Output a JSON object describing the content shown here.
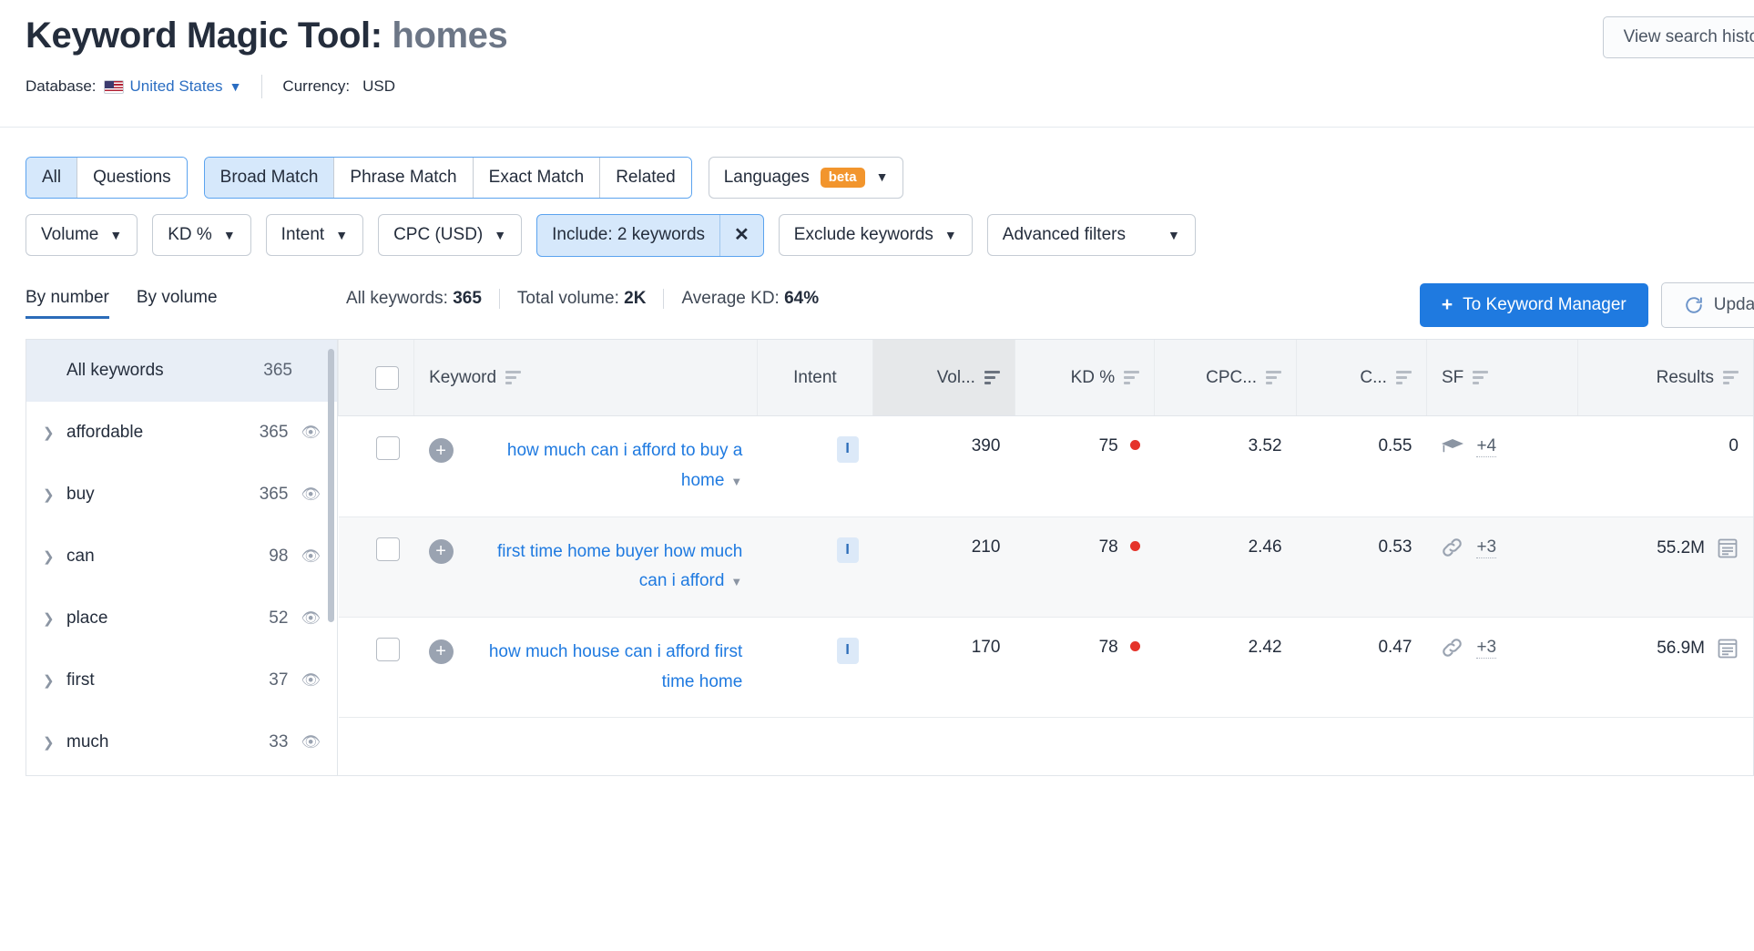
{
  "header": {
    "title_prefix": "Keyword Magic Tool:",
    "title_term": "homes",
    "database_label": "Database:",
    "database_value": "United States",
    "currency_label": "Currency:",
    "currency_value": "USD",
    "view_history_button": "View search history"
  },
  "filters": {
    "type_tabs": [
      {
        "label": "All",
        "active": true
      },
      {
        "label": "Questions",
        "active": false
      }
    ],
    "match_tabs": [
      {
        "label": "Broad Match",
        "active": true
      },
      {
        "label": "Phrase Match",
        "active": false
      },
      {
        "label": "Exact Match",
        "active": false
      },
      {
        "label": "Related",
        "active": false
      }
    ],
    "languages": {
      "label": "Languages",
      "badge": "beta"
    },
    "dropdowns": [
      {
        "label": "Volume"
      },
      {
        "label": "KD %"
      },
      {
        "label": "Intent"
      },
      {
        "label": "CPC (USD)"
      }
    ],
    "include": {
      "label": "Include: 2 keywords",
      "close": "✕"
    },
    "exclude": {
      "label": "Exclude keywords"
    },
    "advanced": {
      "label": "Advanced filters"
    }
  },
  "subbar": {
    "toggles": [
      {
        "label": "By number",
        "active": true
      },
      {
        "label": "By volume",
        "active": false
      }
    ],
    "stats": [
      {
        "label": "All keywords:",
        "value": "365"
      },
      {
        "label": "Total volume:",
        "value": "2K"
      },
      {
        "label": "Average KD:",
        "value": "64%"
      }
    ],
    "keyword_manager_button": "To Keyword Manager",
    "update_button": "Update"
  },
  "sidebar": {
    "root": {
      "label": "All keywords",
      "count": "365"
    },
    "items": [
      {
        "label": "affordable",
        "count": "365"
      },
      {
        "label": "buy",
        "count": "365"
      },
      {
        "label": "can",
        "count": "98"
      },
      {
        "label": "place",
        "count": "52"
      },
      {
        "label": "first",
        "count": "37"
      },
      {
        "label": "much",
        "count": "33"
      }
    ]
  },
  "table": {
    "columns": [
      {
        "key": "checkbox",
        "label": "",
        "align": "center",
        "sorted": false
      },
      {
        "key": "keyword",
        "label": "Keyword",
        "align": "left",
        "sorted": false
      },
      {
        "key": "intent",
        "label": "Intent",
        "align": "center",
        "sorted": false,
        "nosort": true
      },
      {
        "key": "volume",
        "label": "Vol...",
        "align": "right",
        "sorted": true
      },
      {
        "key": "kd",
        "label": "KD %",
        "align": "right",
        "sorted": false
      },
      {
        "key": "cpc",
        "label": "CPC...",
        "align": "right",
        "sorted": false
      },
      {
        "key": "com",
        "label": "C...",
        "align": "right",
        "sorted": false
      },
      {
        "key": "sf",
        "label": "SF",
        "align": "left",
        "sorted": false
      },
      {
        "key": "results",
        "label": "Results",
        "align": "right",
        "sorted": false
      }
    ],
    "rows": [
      {
        "keyword": "how much can i afford to buy a home",
        "intent": "I",
        "volume": "390",
        "kd": "75",
        "kd_dot_color": "#e5332a",
        "cpc": "3.52",
        "com": "0.55",
        "sf_icon": "graduation-cap-icon",
        "sf_more": "+4",
        "results": "0",
        "has_serp_icon": false
      },
      {
        "keyword": "first time home buyer how much can i afford",
        "intent": "I",
        "volume": "210",
        "kd": "78",
        "kd_dot_color": "#e5332a",
        "cpc": "2.46",
        "com": "0.53",
        "sf_icon": "link-icon",
        "sf_more": "+3",
        "results": "55.2M",
        "has_serp_icon": true
      },
      {
        "keyword": "how much house can i afford first time home",
        "intent": "I",
        "volume": "170",
        "kd": "78",
        "kd_dot_color": "#e5332a",
        "cpc": "2.42",
        "com": "0.47",
        "sf_icon": "link-icon",
        "sf_more": "+3",
        "results": "56.9M",
        "has_serp_icon": true
      }
    ]
  },
  "colors": {
    "accent_blue": "#1f7ae0",
    "link_blue": "#2a6dc2",
    "selected_bg": "#d6e8fb",
    "beta_orange": "#f2952d",
    "kd_red": "#e5332a"
  }
}
